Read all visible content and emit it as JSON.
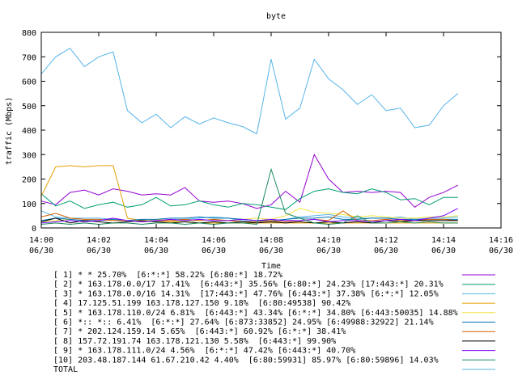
{
  "chart_data": {
    "type": "line",
    "title": "byte",
    "xlabel": "Time",
    "ylabel": "traffic (Mbps)",
    "ylim": [
      0,
      800
    ],
    "yticks": [
      0,
      100,
      200,
      300,
      400,
      500,
      600,
      700,
      800
    ],
    "xlim_minutes": [
      0,
      16
    ],
    "xticks": [
      {
        "t": 0,
        "time": "14:00",
        "date": "06/30"
      },
      {
        "t": 2,
        "time": "14:02",
        "date": "06/30"
      },
      {
        "t": 4,
        "time": "14:04",
        "date": "06/30"
      },
      {
        "t": 6,
        "time": "14:06",
        "date": "06/30"
      },
      {
        "t": 8,
        "time": "14:08",
        "date": "06/30"
      },
      {
        "t": 10,
        "time": "14:10",
        "date": "06/30"
      },
      {
        "t": 12,
        "time": "14:12",
        "date": "06/30"
      },
      {
        "t": 14,
        "time": "14:14",
        "date": "06/30"
      },
      {
        "t": 16,
        "time": "14:16",
        "date": "06/30"
      }
    ],
    "grid": false,
    "legend_position": "bottom",
    "series": [
      {
        "name": "[ 1] * * 25.70%  [6:*:*] 58.22% [6:80:*] 18.72%",
        "color": "#9400d3",
        "x": [
          0,
          0.5,
          1,
          1.5,
          2,
          2.5,
          3,
          3.5,
          4,
          4.5,
          5,
          5.5,
          6,
          6.5,
          7,
          7.5,
          8,
          8.5,
          9,
          9.5,
          10,
          10.5,
          11,
          11.5,
          12,
          12.5,
          13,
          13.5,
          14,
          14.5
        ],
        "values": [
          110,
          95,
          145,
          155,
          135,
          160,
          150,
          135,
          140,
          135,
          165,
          110,
          105,
          110,
          100,
          80,
          95,
          150,
          105,
          300,
          200,
          145,
          150,
          145,
          150,
          145,
          85,
          125,
          145,
          175
        ]
      },
      {
        "name": "[ 2] * 163.178.0.0/17 17.41%  [6:443:*] 35.56% [6:80:*] 24.23% [17:443:*] 20.31%",
        "color": "#009e73",
        "x": [
          0,
          0.5,
          1,
          1.5,
          2,
          2.5,
          3,
          3.5,
          4,
          4.5,
          5,
          5.5,
          6,
          6.5,
          7,
          7.5,
          8,
          8.5,
          9,
          9.5,
          10,
          10.5,
          11,
          11.5,
          12,
          12.5,
          13,
          13.5,
          14,
          14.5
        ],
        "values": [
          140,
          90,
          110,
          80,
          95,
          105,
          85,
          95,
          125,
          90,
          95,
          110,
          95,
          85,
          100,
          95,
          85,
          75,
          120,
          150,
          160,
          145,
          140,
          160,
          145,
          115,
          120,
          95,
          125,
          125
        ]
      },
      {
        "name": "[ 3] * 163.178.0.0/16 14.31%  [17:443:*] 47.76% [6:443:*] 37.38% [6:*:*] 12.05%",
        "color": "#56b4e9",
        "x": [
          0,
          0.5,
          1,
          1.5,
          2,
          2.5,
          3,
          3.5,
          4,
          4.5,
          5,
          5.5,
          6,
          6.5,
          7,
          7.5,
          8,
          8.5,
          9,
          9.5,
          10,
          10.5,
          11,
          11.5,
          12,
          12.5,
          13,
          13.5,
          14,
          14.5
        ],
        "values": [
          70,
          45,
          40,
          40,
          40,
          35,
          30,
          30,
          30,
          35,
          35,
          40,
          45,
          40,
          30,
          25,
          20,
          35,
          45,
          50,
          55,
          45,
          40,
          40,
          40,
          45,
          35,
          40,
          40,
          45
        ]
      },
      {
        "name": "[ 4] 17.125.51.199 163.178.127.150 9.18%  [6:80:49538] 90.42%",
        "color": "#e69f00",
        "x": [
          0,
          0.5,
          1,
          1.5,
          2,
          2.5,
          3,
          3.5,
          4,
          4.5,
          5,
          5.5,
          6,
          6.5,
          7,
          7.5,
          8,
          8.5,
          9,
          9.5,
          10,
          10.5,
          11,
          11.5,
          12,
          12.5,
          13,
          13.5,
          14,
          14.5
        ],
        "values": [
          130,
          250,
          255,
          250,
          255,
          255,
          40,
          30,
          25,
          25,
          25,
          20,
          20,
          20,
          20,
          20,
          20,
          20,
          20,
          20,
          20,
          20,
          20,
          20,
          20,
          20,
          20,
          20,
          20,
          20
        ]
      },
      {
        "name": "[ 5] * 163.178.110.0/24 6.81%  [6:443:*] 43.34% [6:*:*] 34.80% [6:443:50035] 14.88%",
        "color": "#f0e442",
        "x": [
          0,
          0.5,
          1,
          1.5,
          2,
          2.5,
          3,
          3.5,
          4,
          4.5,
          5,
          5.5,
          6,
          6.5,
          7,
          7.5,
          8,
          8.5,
          9,
          9.5,
          10,
          10.5,
          11,
          11.5,
          12,
          12.5,
          13,
          13.5,
          14,
          14.5
        ],
        "values": [
          25,
          30,
          35,
          30,
          30,
          35,
          30,
          30,
          35,
          30,
          30,
          30,
          35,
          30,
          35,
          40,
          35,
          50,
          80,
          65,
          60,
          55,
          45,
          50,
          45,
          40,
          40,
          45,
          45,
          50
        ]
      },
      {
        "name": "[ 6] *:: *:: 6.41%  [6:*:*] 27.64% [6:873:33852] 24.95% [6:49988:32922] 21.14%",
        "color": "#0072b2",
        "x": [
          0,
          0.5,
          1,
          1.5,
          2,
          2.5,
          3,
          3.5,
          4,
          4.5,
          5,
          5.5,
          6,
          6.5,
          7,
          7.5,
          8,
          8.5,
          9,
          9.5,
          10,
          10.5,
          11,
          11.5,
          12,
          12.5,
          13,
          13.5,
          14,
          14.5
        ],
        "values": [
          30,
          40,
          35,
          30,
          30,
          35,
          30,
          35,
          35,
          40,
          40,
          45,
          40,
          40,
          35,
          30,
          30,
          35,
          40,
          40,
          45,
          35,
          35,
          40,
          40,
          35,
          35,
          35,
          35,
          35
        ]
      },
      {
        "name": "[ 7] * 202.124.159.14 5.65%  [6:443:*] 60.92% [6:*:*] 38.41%",
        "color": "#d55e00",
        "x": [
          0,
          0.5,
          1,
          1.5,
          2,
          2.5,
          3,
          3.5,
          4,
          4.5,
          5,
          5.5,
          6,
          6.5,
          7,
          7.5,
          8,
          8.5,
          9,
          9.5,
          10,
          10.5,
          11,
          11.5,
          12,
          12.5,
          13,
          13.5,
          14,
          14.5
        ],
        "values": [
          45,
          60,
          40,
          35,
          35,
          30,
          30,
          25,
          30,
          30,
          35,
          30,
          35,
          30,
          25,
          25,
          30,
          25,
          30,
          35,
          30,
          70,
          30,
          30,
          35,
          30,
          30,
          35,
          35,
          30
        ]
      },
      {
        "name": "[ 8] 157.72.191.74 163.178.121.130 5.58%  [6:443:*] 99.90%",
        "color": "#000000",
        "x": [
          0,
          0.5,
          1,
          1.5,
          2,
          2.5,
          3,
          3.5,
          4,
          4.5,
          5,
          5.5,
          6,
          6.5,
          7,
          7.5,
          8,
          8.5,
          9,
          9.5,
          10,
          10.5,
          11,
          11.5,
          12,
          12.5,
          13,
          13.5,
          14,
          14.5
        ],
        "values": [
          25,
          40,
          20,
          30,
          25,
          20,
          25,
          30,
          25,
          20,
          25,
          20,
          25,
          20,
          25,
          20,
          25,
          20,
          25,
          20,
          25,
          20,
          25,
          20,
          30,
          25,
          30,
          30,
          30,
          30
        ]
      },
      {
        "name": "[ 9] * 163.178.111.0/24 4.56%  [6:*:*] 47.42% [6:443:*] 40.70%",
        "color": "#7b00ff",
        "x": [
          0,
          0.5,
          1,
          1.5,
          2,
          2.5,
          3,
          3.5,
          4,
          4.5,
          5,
          5.5,
          6,
          6.5,
          7,
          7.5,
          8,
          8.5,
          9,
          9.5,
          10,
          10.5,
          11,
          11.5,
          12,
          12.5,
          13,
          13.5,
          14,
          14.5
        ],
        "values": [
          20,
          25,
          30,
          25,
          30,
          40,
          30,
          25,
          30,
          35,
          30,
          35,
          30,
          30,
          35,
          30,
          35,
          30,
          30,
          35,
          25,
          30,
          30,
          25,
          30,
          35,
          30,
          40,
          50,
          80
        ]
      },
      {
        "name": "[10] 203.48.187.144 61.67.210.42 4.40%  [6:80:59931] 85.97% [6:80:59896] 14.03%",
        "color": "#1b8a5a",
        "x": [
          0,
          0.5,
          1,
          1.5,
          2,
          2.5,
          3,
          3.5,
          4,
          4.5,
          5,
          5.5,
          6,
          6.5,
          7,
          7.5,
          8,
          8.5,
          9,
          9.5,
          10,
          10.5,
          11,
          11.5,
          12,
          12.5,
          13,
          13.5,
          14,
          14.5
        ],
        "values": [
          15,
          20,
          15,
          20,
          15,
          20,
          20,
          15,
          20,
          20,
          15,
          20,
          15,
          20,
          20,
          15,
          240,
          60,
          40,
          20,
          15,
          20,
          50,
          20,
          20,
          25,
          20,
          25,
          20,
          20
        ]
      },
      {
        "name": "TOTAL",
        "color": "#56b4e9",
        "x": [
          0,
          0.5,
          1,
          1.5,
          2,
          2.5,
          3,
          3.5,
          4,
          4.5,
          5,
          5.5,
          6,
          6.5,
          7,
          7.5,
          8,
          8.5,
          9,
          9.5,
          10,
          10.5,
          11,
          11.5,
          12,
          12.5,
          13,
          13.5,
          14,
          14.5
        ],
        "values": [
          630,
          700,
          735,
          660,
          700,
          720,
          480,
          430,
          465,
          410,
          455,
          425,
          450,
          430,
          415,
          385,
          690,
          445,
          490,
          690,
          610,
          565,
          505,
          545,
          480,
          490,
          410,
          420,
          500,
          550
        ]
      }
    ]
  }
}
